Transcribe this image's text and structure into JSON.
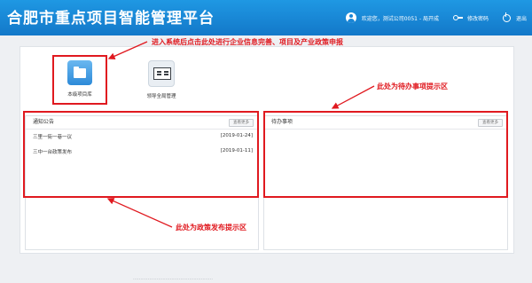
{
  "header": {
    "app_title": "合肥市重点项目智能管理平台",
    "welcome_text": "欢迎您，测试公司0051 - 局开成",
    "change_password_label": "修改密码",
    "logout_label": "退出"
  },
  "quick_links": [
    {
      "label": "本级项目库",
      "icon": "folder-icon"
    },
    {
      "label": "领导全局管理",
      "icon": "screen-report-icon"
    }
  ],
  "notice_panel": {
    "title": "通知公告",
    "more_label": "查看更多",
    "items": [
      {
        "title": "三里一街一巷一议",
        "date": "[2019-01-24]"
      },
      {
        "title": "三中一台政策发布",
        "date": "[2019-01-11]"
      }
    ]
  },
  "todo_panel": {
    "title": "待办事项",
    "more_label": "查看更多"
  },
  "annotations": {
    "top": "进入系统后点击此处进行企业信息完善、项目及产业政策申报",
    "right": "此处为待办事项提示区",
    "bottom": "此处为政策发布提示区"
  },
  "footer": {
    "text": "………………………………………………"
  },
  "colors": {
    "header": "#1a86d6",
    "annotation": "#e0191f"
  }
}
